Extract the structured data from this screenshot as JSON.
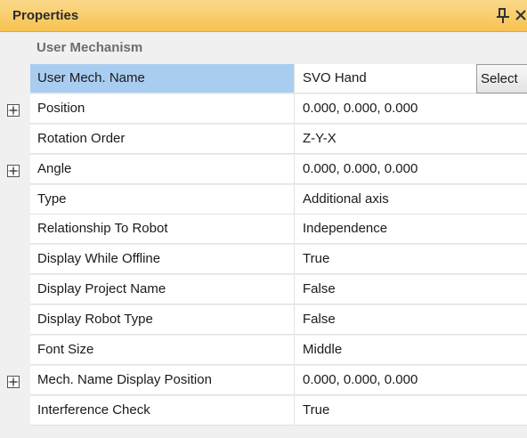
{
  "panel": {
    "title": "Properties",
    "pin_icon": "pin-icon",
    "close_icon": "close-icon"
  },
  "category": {
    "label": "User Mechanism"
  },
  "rows": [
    {
      "name": "User Mech. Name",
      "value": "SVO Hand",
      "selected": true,
      "expandable": false,
      "button": "Select"
    },
    {
      "name": "Position",
      "value": "0.000, 0.000, 0.000",
      "expandable": true
    },
    {
      "name": "Rotation Order",
      "value": "Z-Y-X",
      "expandable": false
    },
    {
      "name": "Angle",
      "value": "0.000, 0.000, 0.000",
      "expandable": true
    },
    {
      "name": "Type",
      "value": "Additional axis",
      "expandable": false
    },
    {
      "name": "Relationship To Robot",
      "value": "Independence",
      "expandable": false
    },
    {
      "name": "Display While Offline",
      "value": "True",
      "expandable": false
    },
    {
      "name": "Display Project Name",
      "value": "False",
      "expandable": false
    },
    {
      "name": "Display Robot Type",
      "value": "False",
      "expandable": false
    },
    {
      "name": "Font Size",
      "value": "Middle",
      "expandable": false
    },
    {
      "name": "Mech. Name Display Position",
      "value": "0.000, 0.000, 0.000",
      "expandable": true
    },
    {
      "name": "Interference Check",
      "value": "True",
      "expandable": false
    }
  ],
  "colors": {
    "title_bar": "#f7c250",
    "selected_row": "#a9cdf1",
    "category_text": "#6d6d6d"
  }
}
